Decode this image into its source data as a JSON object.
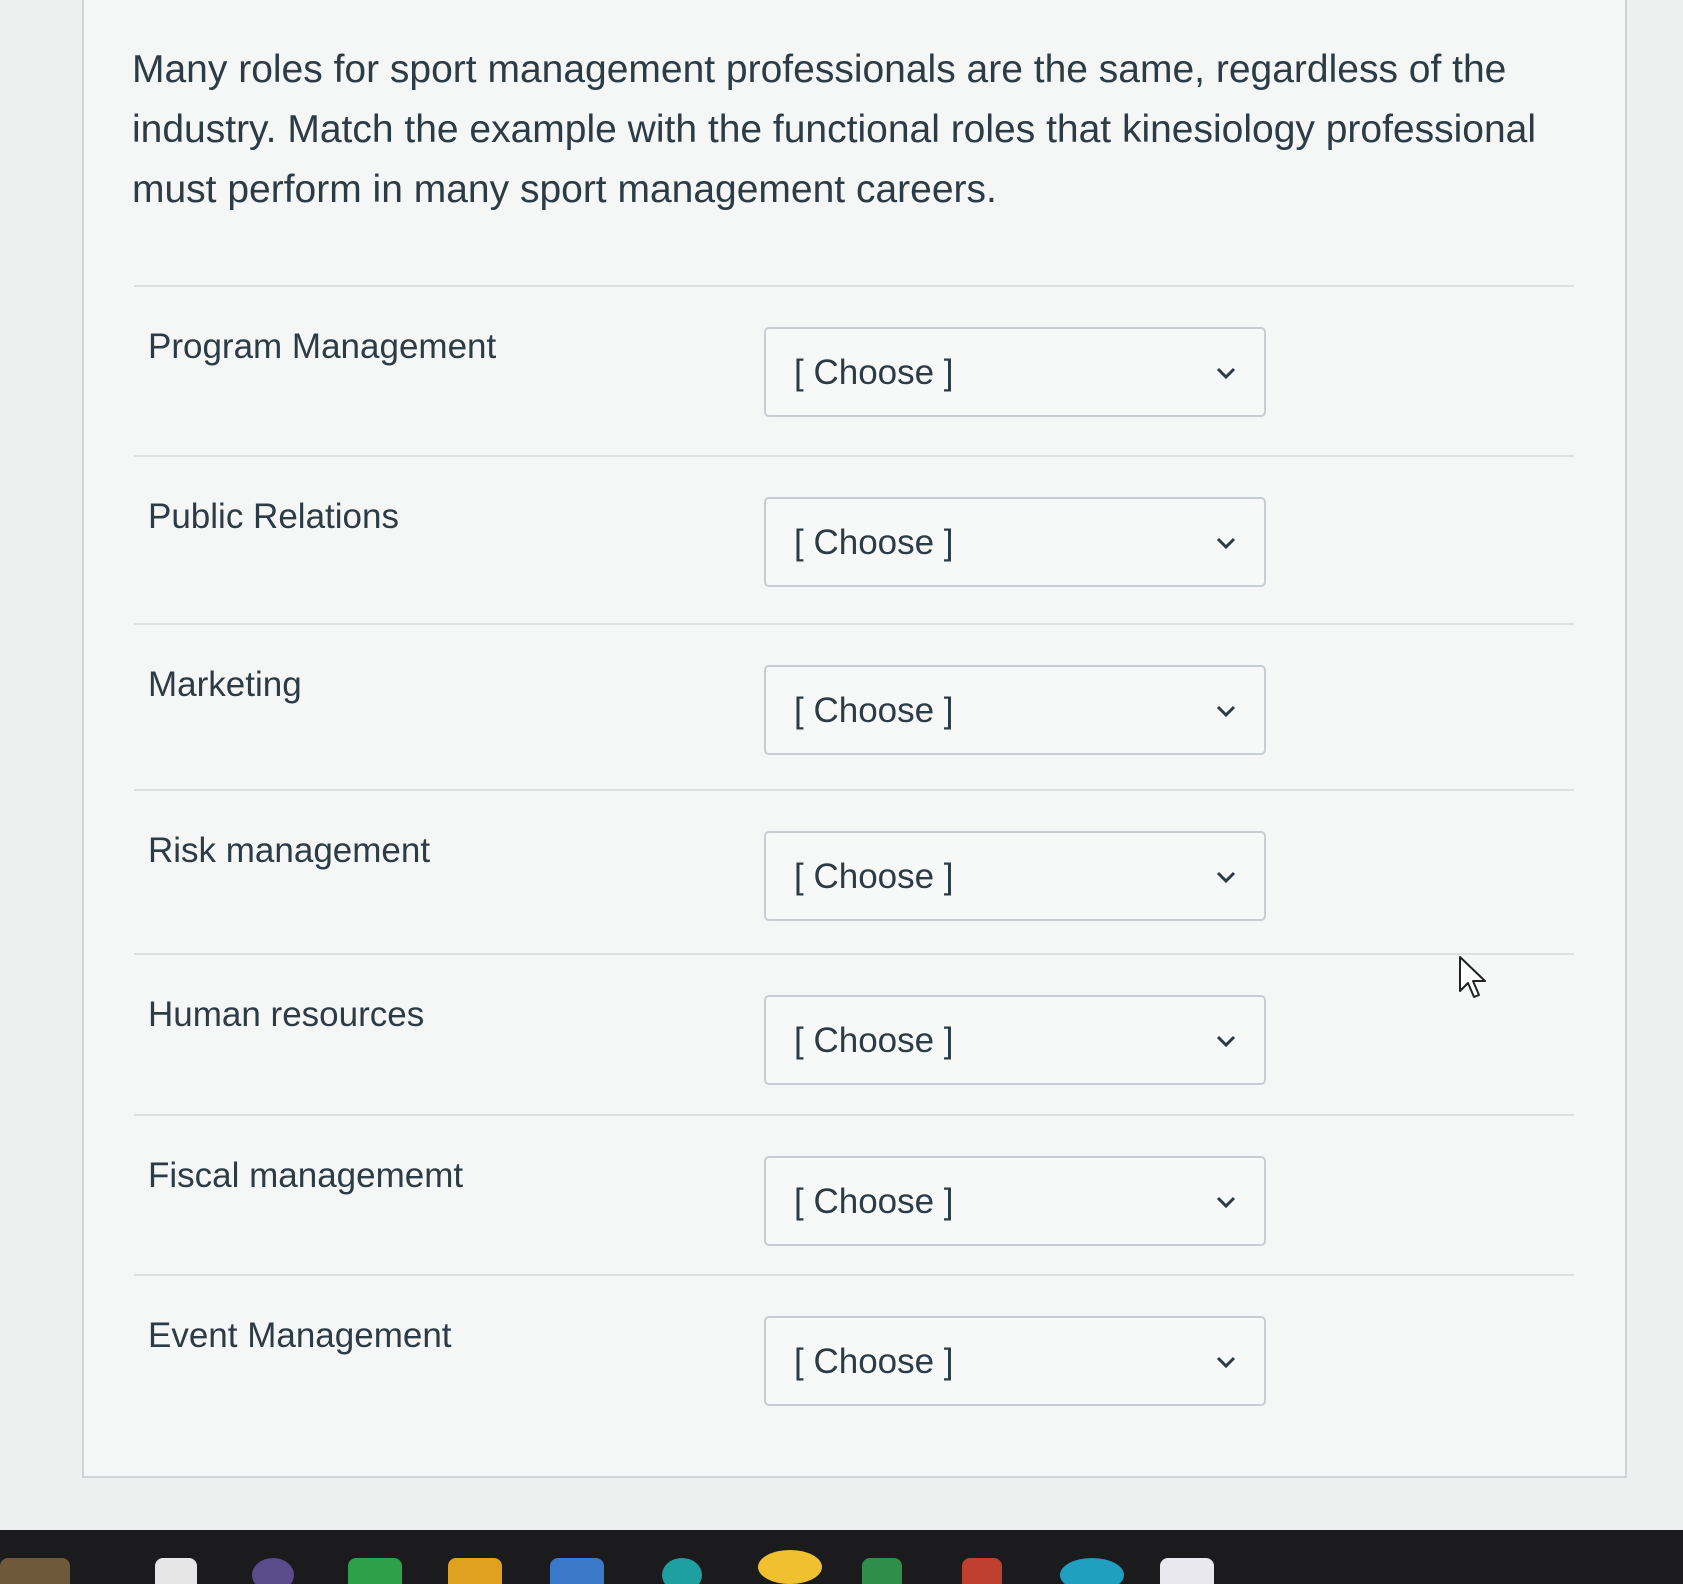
{
  "question": {
    "text": "Many roles for sport management professionals are the same, regardless of the industry. Match the example with the functional roles that kinesiology professional must perform in many sport management careers."
  },
  "matches": [
    {
      "label": "Program Management",
      "selected": "[ Choose ]"
    },
    {
      "label": "Public Relations",
      "selected": "[ Choose ]"
    },
    {
      "label": "Marketing",
      "selected": "[ Choose ]"
    },
    {
      "label": "Risk management",
      "selected": "[ Choose ]"
    },
    {
      "label": "Human resources",
      "selected": "[ Choose ]"
    },
    {
      "label": "Fiscal managememt",
      "selected": "[ Choose ]"
    },
    {
      "label": "Event Management",
      "selected": "[ Choose ]"
    }
  ],
  "icons": {
    "dropdown": "chevron-down-icon",
    "pointer": "mouse-cursor-icon"
  },
  "colors": {
    "text": "#2d3b45",
    "card_background": "#f5f6f6",
    "border": "#c7cdd1",
    "taskbar": "#1b1b1d"
  }
}
